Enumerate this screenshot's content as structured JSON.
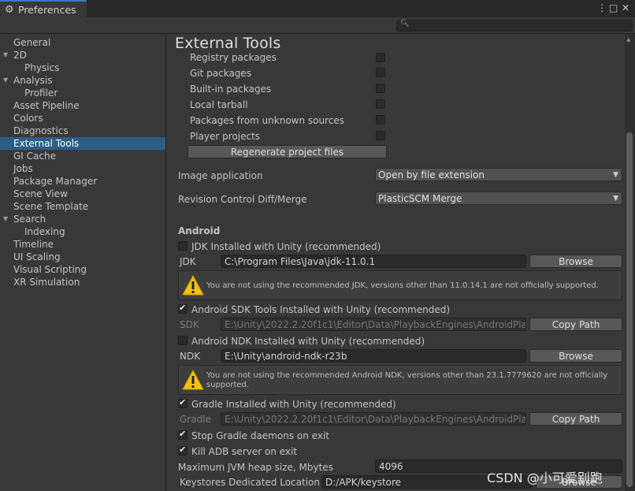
{
  "window": {
    "tab_title": "Preferences"
  },
  "sidebar": {
    "items": [
      {
        "label": "General"
      },
      {
        "label": "2D"
      },
      {
        "label": "Physics"
      },
      {
        "label": "Analysis"
      },
      {
        "label": "Profiler"
      },
      {
        "label": "Asset Pipeline"
      },
      {
        "label": "Colors"
      },
      {
        "label": "Diagnostics"
      },
      {
        "label": "External Tools"
      },
      {
        "label": "GI Cache"
      },
      {
        "label": "Jobs"
      },
      {
        "label": "Package Manager"
      },
      {
        "label": "Scene View"
      },
      {
        "label": "Scene Template"
      },
      {
        "label": "Search"
      },
      {
        "label": "Indexing"
      },
      {
        "label": "Timeline"
      },
      {
        "label": "UI Scaling"
      },
      {
        "label": "Visual Scripting"
      },
      {
        "label": "XR Simulation"
      }
    ]
  },
  "main": {
    "title": "External Tools",
    "packages": [
      {
        "label": "Registry packages",
        "checked": false
      },
      {
        "label": "Git packages",
        "checked": false
      },
      {
        "label": "Built-in packages",
        "checked": false
      },
      {
        "label": "Local tarball",
        "checked": false
      },
      {
        "label": "Packages from unknown sources",
        "checked": false
      },
      {
        "label": "Player projects",
        "checked": false
      }
    ],
    "regenerate_label": "Regenerate project files",
    "image_application": {
      "label": "Image application",
      "value": "Open by file extension"
    },
    "revision_control": {
      "label": "Revision Control Diff/Merge",
      "value": "PlasticSCM Merge"
    },
    "android": {
      "header": "Android",
      "jdk_installed_label": "JDK Installed with Unity (recommended)",
      "jdk_label": "JDK",
      "jdk_path": "C:\\Program Files\\Java\\jdk-11.0.1",
      "jdk_warning": "You are not using the recommended JDK, versions other than 11.0.14.1 are not officially supported.",
      "sdk_installed_label": "Android SDK Tools Installed with Unity (recommended)",
      "sdk_label": "SDK",
      "sdk_path": "E:\\Unity\\2022.2.20f1c1\\Editor\\Data\\PlaybackEngines\\AndroidPlayer\\",
      "ndk_installed_label": "Android NDK Installed with Unity (recommended)",
      "ndk_label": "NDK",
      "ndk_path": "E:\\Unity\\android-ndk-r23b",
      "ndk_warning_line1": "You are not using the recommended Android NDK, versions other than 23.1.7779620 are not officially",
      "ndk_warning_line2": "supported.",
      "gradle_installed_label": "Gradle Installed with Unity (recommended)",
      "gradle_label": "Gradle",
      "gradle_path": "E:\\Unity\\2022.2.20f1c1\\Editor\\Data\\PlaybackEngines\\AndroidPlayer\\",
      "stop_gradle_label": "Stop Gradle daemons on exit",
      "kill_adb_label": "Kill ADB server on exit",
      "jvm_heap_label": "Maximum JVM heap size, Mbytes",
      "jvm_heap_value": "4096",
      "keystores_label": "Keystores Dedicated Location",
      "keystores_value": "D:/APK/keystore",
      "browse_label": "Browse",
      "copy_path_label": "Copy Path",
      "checks": {
        "jdk_installed": false,
        "sdk_installed": true,
        "ndk_installed": false,
        "gradle_installed": true,
        "stop_gradle": true,
        "kill_adb": true
      }
    }
  },
  "watermark": "CSDN @小可爱别跑",
  "colors": {
    "selection": "#2c5d87",
    "background": "#383838",
    "warning": "#f4c20d"
  }
}
